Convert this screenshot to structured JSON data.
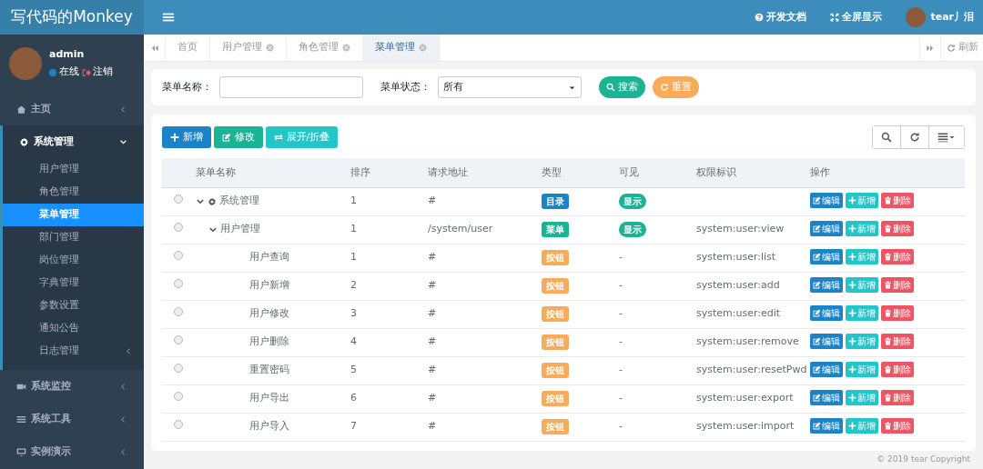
{
  "brand": "写代码的Monkey",
  "topbar": {
    "links": [
      {
        "label": "开发文档"
      },
      {
        "label": "全屏显示"
      }
    ],
    "user": "tear丿泪"
  },
  "user_panel": {
    "name": "admin",
    "status": "在线",
    "logout": "注销"
  },
  "sidebar": {
    "items": [
      {
        "label": "主页",
        "expanded": false
      },
      {
        "label": "系统管理",
        "expanded": true,
        "children": [
          {
            "label": "用户管理",
            "selected": false
          },
          {
            "label": "角色管理",
            "selected": false
          },
          {
            "label": "菜单管理",
            "selected": true
          },
          {
            "label": "部门管理",
            "selected": false
          },
          {
            "label": "岗位管理",
            "selected": false
          },
          {
            "label": "字典管理",
            "selected": false
          },
          {
            "label": "参数设置",
            "selected": false
          },
          {
            "label": "通知公告",
            "selected": false
          },
          {
            "label": "日志管理",
            "selected": false,
            "has_children": true
          }
        ]
      },
      {
        "label": "系统监控",
        "expanded": false
      },
      {
        "label": "系统工具",
        "expanded": false
      },
      {
        "label": "实例演示",
        "expanded": false
      }
    ]
  },
  "tabs": [
    {
      "label": "首页",
      "closable": false,
      "selected": false
    },
    {
      "label": "用户管理",
      "closable": true,
      "selected": false
    },
    {
      "label": "角色管理",
      "closable": true,
      "selected": false
    },
    {
      "label": "菜单管理",
      "closable": true,
      "selected": true
    }
  ],
  "refresh": "刷新",
  "search": {
    "name_label": "菜单名称：",
    "status_label": "菜单状态：",
    "status_value": "所有",
    "search_button": "搜索",
    "reset_button": "重置"
  },
  "toolbar": [
    {
      "label": "新增",
      "kind": "add"
    },
    {
      "label": "修改",
      "kind": "edit"
    },
    {
      "label": "展开/折叠",
      "kind": "toggle"
    }
  ],
  "table": {
    "columns": [
      "菜单名称",
      "排序",
      "请求地址",
      "类型",
      "可见",
      "权限标识",
      "操作"
    ],
    "rows": [
      {
        "name": "系统管理",
        "expanded": true,
        "selected": false,
        "order": "1",
        "url": "#",
        "type": {
          "text": "目录",
          "kind": "directory"
        },
        "visible": {
          "text": "显示",
          "kind": "badge"
        },
        "actions": [
          "编辑",
          "新增",
          "删除"
        ],
        "children": [
          {
            "name": "用户管理",
            "expanded": true,
            "selected": false,
            "order": "1",
            "url": "/system/user",
            "type": {
              "text": "菜单",
              "kind": "menu"
            },
            "visible": {
              "text": "显示",
              "kind": "badge"
            },
            "perms": "system:user:view",
            "actions": [
              "编辑",
              "新增",
              "删除"
            ],
            "children": [
              {
                "name": "用户查询",
                "selected": false,
                "order": "1",
                "url": "#",
                "type": {
                  "text": "按钮",
                  "kind": "button"
                },
                "visible": {
                  "text": "-",
                  "kind": "text"
                },
                "perms": "system:user:list",
                "actions": [
                  "编辑",
                  "新增",
                  "删除"
                ]
              },
              {
                "name": "用户新增",
                "selected": false,
                "order": "2",
                "url": "#",
                "type": {
                  "text": "按钮",
                  "kind": "button"
                },
                "visible": {
                  "text": "-",
                  "kind": "text"
                },
                "perms": "system:user:add",
                "actions": [
                  "编辑",
                  "新增",
                  "删除"
                ]
              },
              {
                "name": "用户修改",
                "selected": false,
                "order": "3",
                "url": "#",
                "type": {
                  "text": "按钮",
                  "kind": "button"
                },
                "visible": {
                  "text": "-",
                  "kind": "text"
                },
                "perms": "system:user:edit",
                "actions": [
                  "编辑",
                  "新增",
                  "删除"
                ]
              },
              {
                "name": "用户删除",
                "selected": false,
                "order": "4",
                "url": "#",
                "type": {
                  "text": "按钮",
                  "kind": "button"
                },
                "visible": {
                  "text": "-",
                  "kind": "text"
                },
                "perms": "system:user:remove",
                "actions": [
                  "编辑",
                  "新增",
                  "删除"
                ]
              },
              {
                "name": "重置密码",
                "selected": false,
                "order": "5",
                "url": "#",
                "type": {
                  "text": "按钮",
                  "kind": "button"
                },
                "visible": {
                  "text": "-",
                  "kind": "text"
                },
                "perms": "system:user:resetPwd",
                "actions": [
                  "编辑",
                  "新增",
                  "删除"
                ]
              },
              {
                "name": "用户导出",
                "selected": false,
                "order": "6",
                "url": "#",
                "type": {
                  "text": "按钮",
                  "kind": "button"
                },
                "visible": {
                  "text": "-",
                  "kind": "text"
                },
                "perms": "system:user:export",
                "actions": [
                  "编辑",
                  "新增",
                  "删除"
                ]
              },
              {
                "name": "用户导入",
                "selected": false,
                "order": "7",
                "url": "#",
                "type": {
                  "text": "按钮",
                  "kind": "button"
                },
                "visible": {
                  "text": "-",
                  "kind": "text"
                },
                "perms": "system:user:import",
                "actions": [
                  "编辑",
                  "新增",
                  "删除"
                ]
              }
            ]
          }
        ]
      }
    ]
  },
  "footer": "© 2019 tear Copyright"
}
